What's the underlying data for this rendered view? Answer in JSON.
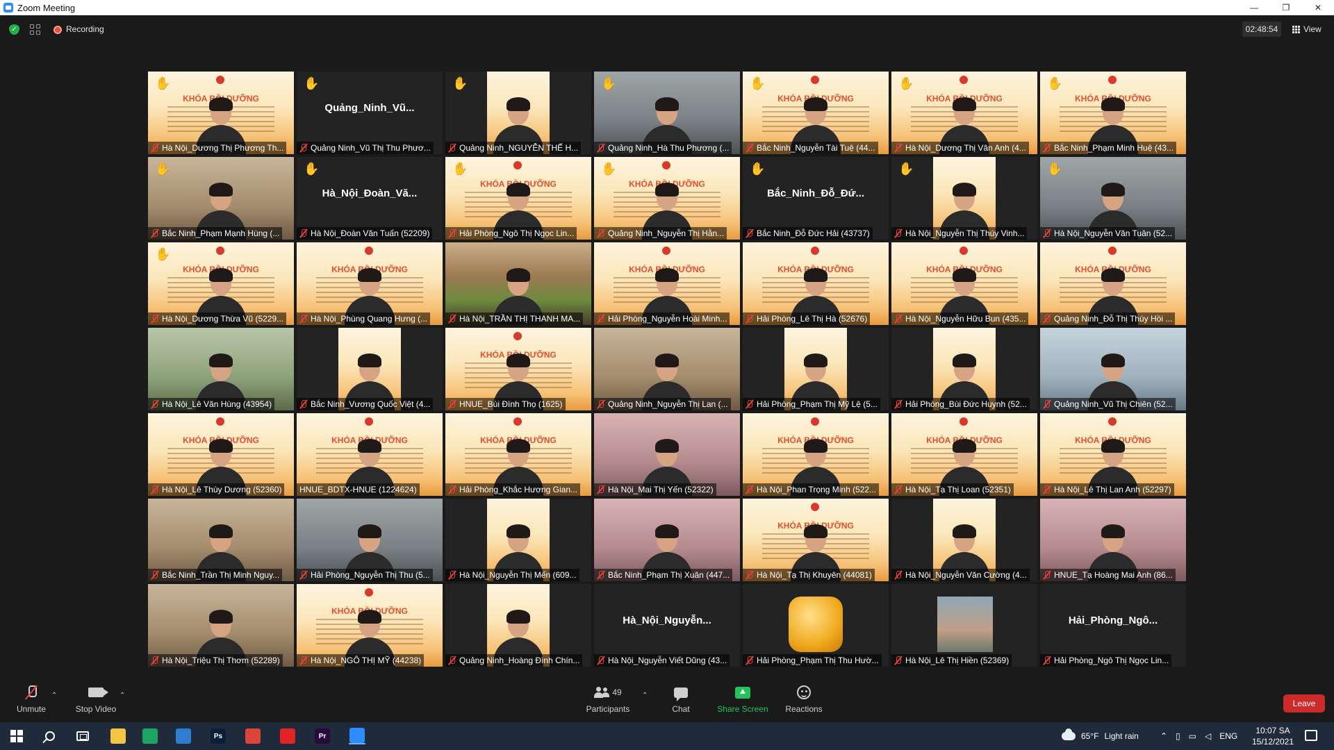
{
  "window": {
    "title": "Zoom Meeting",
    "minimize": "—",
    "restore": "❐",
    "close": "✕"
  },
  "meeting": {
    "recording_label": "Recording",
    "timer": "02:48:54",
    "view_label": "View"
  },
  "tiles": [
    {
      "name": "Hà Nội_Dương Thị Phương Th...",
      "bg": "banner",
      "hand": true
    },
    {
      "name": "Quảng Ninh_Vũ Thị Thu Phươ...",
      "bg": "dark",
      "hand": true,
      "center": "Quảng_Ninh_Vũ..."
    },
    {
      "name": "Quảng Ninh_NGUYỄN THẾ H...",
      "bg": "inset",
      "hand": true
    },
    {
      "name": "Quảng Ninh_Hà Thu Phương (...",
      "bg": "room-grey",
      "hand": true
    },
    {
      "name": "Bắc Ninh_Nguyễn Tài Tuệ (44...",
      "bg": "banner",
      "hand": true
    },
    {
      "name": "Hà Nội_Dương Thị Vân Anh (4...",
      "bg": "banner",
      "hand": true
    },
    {
      "name": "Bắc Ninh_Phạm Minh Huệ (43...",
      "bg": "banner",
      "hand": true
    },
    {
      "name": "Bắc Ninh_Phạm Mạnh Hùng (...",
      "bg": "room-warm",
      "hand": true
    },
    {
      "name": "Hà Nội_Đoàn Văn Tuấn (52209)",
      "bg": "dark",
      "hand": true,
      "center": "Hà_Nội_Đoàn_Vă..."
    },
    {
      "name": "Hải Phòng_Ngô Thị Ngọc Lin...",
      "bg": "banner",
      "hand": true
    },
    {
      "name": "Quảng Ninh_Nguyễn Thị Hằn...",
      "bg": "banner",
      "hand": true
    },
    {
      "name": "Bắc Ninh_Đỗ Đức Hải (43737)",
      "bg": "dark",
      "hand": true,
      "center": "Bắc_Ninh_Đỗ_Đứ..."
    },
    {
      "name": "Hà Nội_Nguyễn Thị Thúy Vinh...",
      "bg": "inset",
      "hand": true
    },
    {
      "name": "Hà Nội_Nguyễn Văn Tuân (52...",
      "bg": "room-grey",
      "hand": true
    },
    {
      "name": "Hà Nội_Dương Thừa Vũ (5229...",
      "bg": "banner",
      "hand": true
    },
    {
      "name": "Hà Nội_Phùng Quang Hưng (...",
      "bg": "banner",
      "hand": false
    },
    {
      "name": "Hà Nội_TRẦN THỊ THANH MA...",
      "bg": "landscape",
      "hand": false
    },
    {
      "name": "Hải Phòng_Nguyễn Hoài Minh...",
      "bg": "banner",
      "hand": false
    },
    {
      "name": "Hải Phòng_Lê Thị Hà (52676)",
      "bg": "banner",
      "hand": false
    },
    {
      "name": "Hà Nội_Nguyễn Hữu Bun (435...",
      "bg": "banner",
      "hand": false
    },
    {
      "name": "Quảng Ninh_Đỗ Thị Thúy Hồi ...",
      "bg": "banner",
      "hand": false
    },
    {
      "name": "Hà Nội_Lê Văn Hùng (43954)",
      "bg": "room-green",
      "hand": false
    },
    {
      "name": "Bắc Ninh_Vương Quốc Việt (4...",
      "bg": "inset",
      "hand": false
    },
    {
      "name": "HNUE_Bùi Đình Thọ (1625)",
      "bg": "banner",
      "hand": false
    },
    {
      "name": "Quảng Ninh_Nguyễn Thị Lan (...",
      "bg": "room-warm",
      "hand": false
    },
    {
      "name": "Hải Phòng_Phạm Thị Mỹ Lệ (5...",
      "bg": "inset",
      "hand": false
    },
    {
      "name": "Hải Phòng_Bùi Đức Huynh (52...",
      "bg": "inset",
      "hand": false
    },
    {
      "name": "Quảng Ninh_Vũ Thị Chiên (52...",
      "bg": "room-blue",
      "hand": false
    },
    {
      "name": "Hà Nội_Lê Thùy Dương (52360)",
      "bg": "banner",
      "hand": false
    },
    {
      "name": "HNUE_BDTX-HNUE (1224624)",
      "bg": "banner",
      "hand": false,
      "active": true,
      "unmuted": true
    },
    {
      "name": "Hải Phòng_Khắc Hương Gian...",
      "bg": "banner",
      "hand": false
    },
    {
      "name": "Hà Nội_Mai Thị Yến (52322)",
      "bg": "room-pink",
      "hand": false
    },
    {
      "name": "Hà Nội_Phan Trọng Minh (522...",
      "bg": "banner",
      "hand": false
    },
    {
      "name": "Hà Nội_Tạ Thị Loan (52351)",
      "bg": "banner",
      "hand": false
    },
    {
      "name": "Hà Nội_Lê Thị Lan Anh (52297)",
      "bg": "banner",
      "hand": false
    },
    {
      "name": "Bắc Ninh_Trần Thị Minh Nguy...",
      "bg": "room-warm",
      "hand": false
    },
    {
      "name": "Hải Phòng_Nguyễn Thị Thu (5...",
      "bg": "room-grey",
      "hand": false
    },
    {
      "name": "Hà Nội_Nguyễn Thị Mến (609...",
      "bg": "inset",
      "hand": false
    },
    {
      "name": "Bắc Ninh_Phạm Thị Xuân (447...",
      "bg": "room-pink",
      "hand": false
    },
    {
      "name": "Hà Nội_Tạ Thị Khuyên (44081)",
      "bg": "banner",
      "hand": false
    },
    {
      "name": "Hà Nội_Nguyễn Văn Cường (4...",
      "bg": "inset",
      "hand": false
    },
    {
      "name": "HNUE_Tạ Hoàng Mai Anh (86...",
      "bg": "room-pink",
      "hand": false
    },
    {
      "name": "Hà Nội_Triệu Thị Thơm (52289)",
      "bg": "room-warm",
      "hand": false
    },
    {
      "name": "Hà Nội_NGÔ THỊ MỸ (44238)",
      "bg": "banner",
      "hand": false
    },
    {
      "name": "Quảng Ninh_Hoàng Đình Chín...",
      "bg": "inset",
      "hand": false
    },
    {
      "name": "Hà Nội_Nguyễn Viết Dũng (43...",
      "bg": "dark",
      "hand": false,
      "center": "Hà_Nội_Nguyễn..."
    },
    {
      "name": "Hải Phòng_Phạm Thị Thu Hườ...",
      "bg": "avatar-gold",
      "hand": false
    },
    {
      "name": "Hà Nội_Lê Thị Hiền (52369)",
      "bg": "avatar-photo",
      "hand": false
    },
    {
      "name": "Hải Phòng_Ngô Thị Ngọc Lin...",
      "bg": "dark",
      "hand": false,
      "center": "Hải_Phòng_Ngô..."
    }
  ],
  "banner_title": "KHÓA BỒI DƯỠNG",
  "toolbar": {
    "unmute": "Unmute",
    "stop_video": "Stop Video",
    "participants": "Participants",
    "participants_count": "49",
    "chat": "Chat",
    "share_screen": "Share Screen",
    "reactions": "Reactions",
    "leave": "Leave"
  },
  "taskbar": {
    "temperature": "65°F",
    "weather": "Light rain",
    "language": "ENG",
    "time": "10:07 SA",
    "date": "15/12/2021",
    "apps": [
      {
        "name": "file-explorer",
        "color": "#f4c542",
        "label": ""
      },
      {
        "name": "chrome-alt",
        "color": "#1da462",
        "label": ""
      },
      {
        "name": "store",
        "color": "#2d7dd2",
        "label": ""
      },
      {
        "name": "photoshop",
        "color": "#0b1f3a",
        "label": "Ps"
      },
      {
        "name": "chrome",
        "color": "#db4437",
        "label": ""
      },
      {
        "name": "messenger",
        "color": "#e02424",
        "label": ""
      },
      {
        "name": "premiere",
        "color": "#2a0b3d",
        "label": "Pr"
      },
      {
        "name": "zoom",
        "color": "#2d8cff",
        "label": ""
      }
    ]
  },
  "colors": {
    "accent_green": "#23c25a",
    "leave_red": "#cd2a2a",
    "active_speaker": "#7bd83b"
  }
}
